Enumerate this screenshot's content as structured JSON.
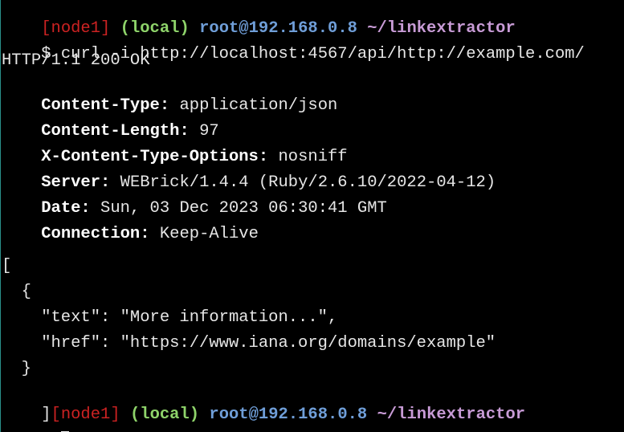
{
  "prompt1": {
    "host": "[node1]",
    "env": "(local)",
    "user_host": "root@192.168.0.8",
    "path": "~/linkextractor"
  },
  "command": {
    "sign": "$",
    "text": "curl -i http://localhost:4567/api/http://example.com/"
  },
  "response": {
    "status": "HTTP/1.1 200 OK",
    "headers": [
      {
        "name": "Content-Type:",
        "value": "application/json"
      },
      {
        "name": "Content-Length:",
        "value": "97"
      },
      {
        "name": "X-Content-Type-Options:",
        "value": "nosniff"
      },
      {
        "name": "Server:",
        "value": "WEBrick/1.4.4 (Ruby/2.6.10/2022-04-12)"
      },
      {
        "name": "Date:",
        "value": "Sun, 03 Dec 2023 06:30:41 GMT"
      },
      {
        "name": "Connection:",
        "value": "Keep-Alive"
      }
    ],
    "body": [
      "[",
      "  {",
      "    \"text\": \"More information...\",",
      "    \"href\": \"https://www.iana.org/domains/example\"",
      "  }"
    ]
  },
  "prompt2": {
    "prefix": "]",
    "host": "[node1]",
    "env": "(local)",
    "user_host": "root@192.168.0.8",
    "path": "~/linkextractor"
  },
  "input_line": {
    "sign": "$"
  },
  "colors": {
    "host": "#cc2222",
    "env": "#8ed36a",
    "user_host": "#6f9ed8",
    "path": "#c89bd6",
    "background": "#000000",
    "text": "#e6e6e6"
  }
}
